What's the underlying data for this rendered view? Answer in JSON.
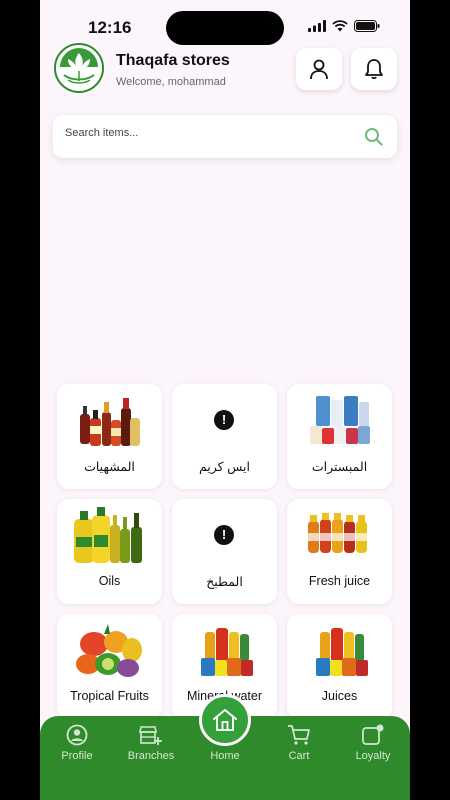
{
  "status_bar": {
    "time": "12:16"
  },
  "header": {
    "title": "Thaqafa stores",
    "welcome": "Welcome, mohammad"
  },
  "search": {
    "placeholder": "Search items..."
  },
  "categories": [
    {
      "label": "المشهيات",
      "icon": "condiments-image"
    },
    {
      "label": "ايس كريم",
      "icon": "missing-image-icon"
    },
    {
      "label": "المبسترات",
      "icon": "dairy-image"
    },
    {
      "label": "Oils",
      "icon": "oil-bottles-image"
    },
    {
      "label": "المطبخ",
      "icon": "missing-image-icon"
    },
    {
      "label": "Fresh juice",
      "icon": "juice-bottles-image"
    },
    {
      "label": "Tropical Fruits",
      "icon": "fruits-image"
    },
    {
      "label": "Mineral water",
      "icon": "drinks-image"
    },
    {
      "label": "Juices",
      "icon": "drinks-image"
    }
  ],
  "nav": {
    "profile": "Profile",
    "branches": "Branches",
    "home": "Home",
    "cart": "Cart",
    "loyalty": "Loyalty"
  },
  "colors": {
    "brand_green": "#2f8a2b",
    "background": "#fdf5fc"
  }
}
